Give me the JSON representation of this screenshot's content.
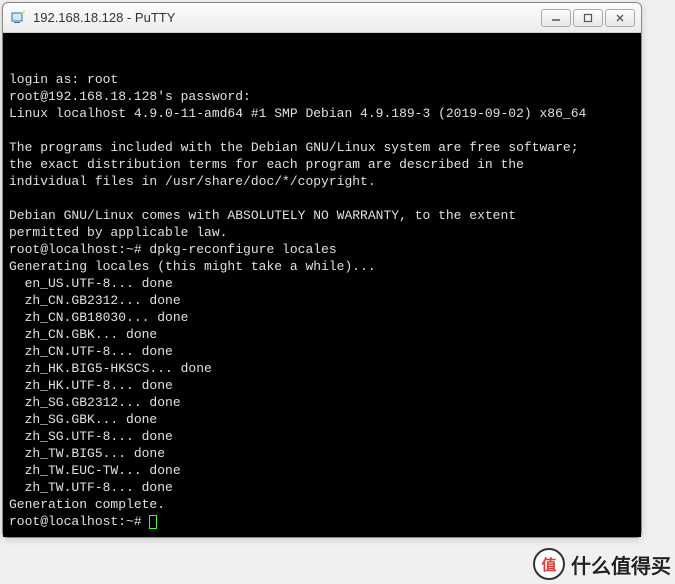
{
  "window": {
    "title": "192.168.18.128 - PuTTY"
  },
  "terminal": {
    "lines": [
      "login as: root",
      "root@192.168.18.128's password:",
      "Linux localhost 4.9.0-11-amd64 #1 SMP Debian 4.9.189-3 (2019-09-02) x86_64",
      "",
      "The programs included with the Debian GNU/Linux system are free software;",
      "the exact distribution terms for each program are described in the",
      "individual files in /usr/share/doc/*/copyright.",
      "",
      "Debian GNU/Linux comes with ABSOLUTELY NO WARRANTY, to the extent",
      "permitted by applicable law.",
      "root@localhost:~# dpkg-reconfigure locales",
      "Generating locales (this might take a while)...",
      "  en_US.UTF-8... done",
      "  zh_CN.GB2312... done",
      "  zh_CN.GB18030... done",
      "  zh_CN.GBK... done",
      "  zh_CN.UTF-8... done",
      "  zh_HK.BIG5-HKSCS... done",
      "  zh_HK.UTF-8... done",
      "  zh_SG.GB2312... done",
      "  zh_SG.GBK... done",
      "  zh_SG.UTF-8... done",
      "  zh_TW.BIG5... done",
      "  zh_TW.EUC-TW... done",
      "  zh_TW.UTF-8... done",
      "Generation complete."
    ],
    "prompt": "root@localhost:~# "
  },
  "watermark": {
    "badge": "值",
    "text": "什么值得买"
  }
}
